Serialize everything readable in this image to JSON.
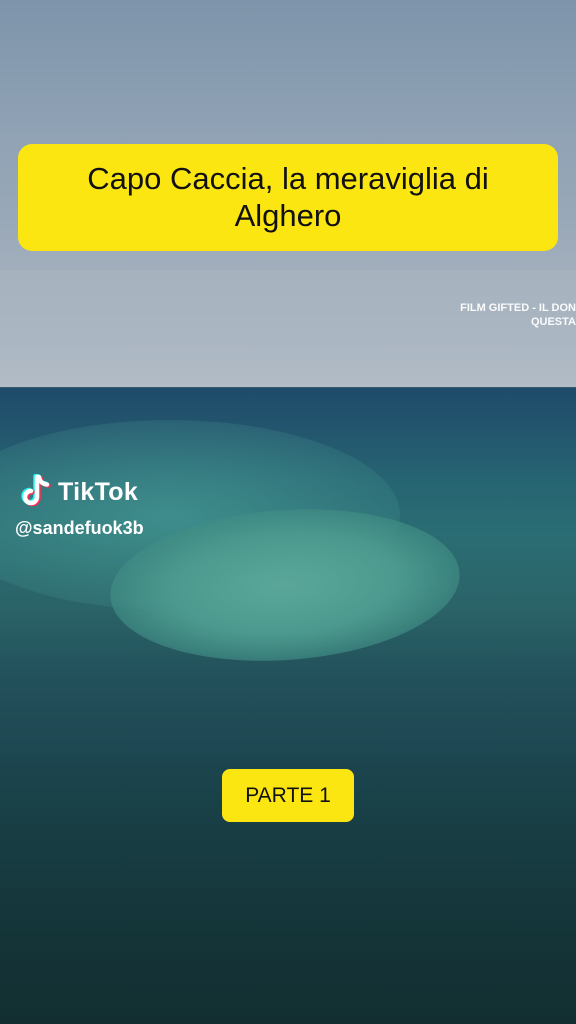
{
  "caption": {
    "title": "Capo Caccia, la meraviglia di Alghero"
  },
  "video": {
    "credit_text": "FILM GIFTED - IL DON\nQUESTA"
  },
  "watermark": {
    "brand": "TikTok",
    "handle": "@sandefuok3b",
    "icon": "tiktok-logo-icon"
  },
  "badge": {
    "label": "PARTE 1"
  },
  "colors": {
    "caption_background": "#fbe612",
    "caption_text": "#111111",
    "watermark_text": "#ffffff"
  }
}
